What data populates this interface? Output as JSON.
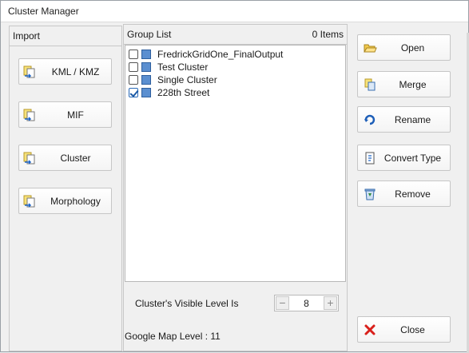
{
  "window": {
    "title": "Cluster Manager"
  },
  "import_panel": {
    "header": "Import",
    "buttons": [
      {
        "label": "KML / KMZ",
        "icon": "import-file-icon"
      },
      {
        "label": "MIF",
        "icon": "import-file-icon"
      },
      {
        "label": "Cluster",
        "icon": "import-file-icon"
      },
      {
        "label": "Morphology",
        "icon": "import-file-icon"
      }
    ]
  },
  "group_panel": {
    "header": "Group List",
    "item_count": "0 Items",
    "items": [
      {
        "label": "FredrickGridOne_FinalOutput",
        "checked": false
      },
      {
        "label": "Test Cluster",
        "checked": false
      },
      {
        "label": "Single Cluster",
        "checked": false
      },
      {
        "label": "228th Street",
        "checked": true
      }
    ],
    "visible_level_label": "Cluster's Visible Level Is",
    "visible_level_value": "8",
    "google_map_level": "Google Map Level : 11"
  },
  "actions": {
    "open": "Open",
    "merge": "Merge",
    "rename": "Rename",
    "convert_type": "Convert Type",
    "remove": "Remove",
    "close": "Close"
  },
  "colors": {
    "close_icon": "#d9201b",
    "folder_icon": "#f2c94c",
    "item_square": "#5b8fd0"
  }
}
